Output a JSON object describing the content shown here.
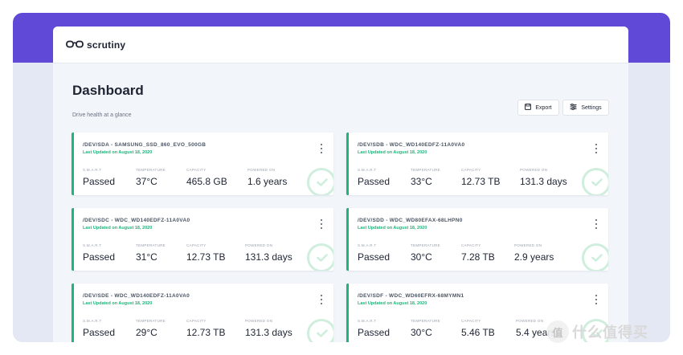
{
  "app": {
    "logo_text": "scrutiny"
  },
  "page": {
    "title": "Dashboard",
    "subtitle": "Drive health at a glance"
  },
  "toolbar": {
    "export_label": "Export",
    "settings_label": "Settings"
  },
  "stat_labels": {
    "smart": "S.M.A.R.T",
    "temperature": "TEMPERATURE",
    "capacity": "CAPACITY",
    "powered_on": "POWERED ON"
  },
  "drives": [
    {
      "name": "/DEV/SDA - SAMSUNG_SSD_860_EVO_500GB",
      "updated": "Last Updated on August 18, 2020",
      "smart": "Passed",
      "temperature": "37°C",
      "capacity": "465.8 GB",
      "powered_on": "1.6 years"
    },
    {
      "name": "/DEV/SDB - WDC_WD140EDFZ-11A0VA0",
      "updated": "Last Updated on August 18, 2020",
      "smart": "Passed",
      "temperature": "33°C",
      "capacity": "12.73 TB",
      "powered_on": "131.3 days"
    },
    {
      "name": "/DEV/SDC - WDC_WD140EDFZ-11A0VA0",
      "updated": "Last Updated on August 18, 2020",
      "smart": "Passed",
      "temperature": "31°C",
      "capacity": "12.73 TB",
      "powered_on": "131.3 days"
    },
    {
      "name": "/DEV/SDD - WDC_WD80EFAX-68LHPN0",
      "updated": "Last Updated on August 18, 2020",
      "smart": "Passed",
      "temperature": "30°C",
      "capacity": "7.28 TB",
      "powered_on": "2.9 years"
    },
    {
      "name": "/DEV/SDE - WDC_WD140EDFZ-11A0VA0",
      "updated": "Last Updated on August 18, 2020",
      "smart": "Passed",
      "temperature": "29°C",
      "capacity": "12.73 TB",
      "powered_on": "131.3 days"
    },
    {
      "name": "/DEV/SDF - WDC_WD60EFRX-68MYMN1",
      "updated": "Last Updated on August 18, 2020",
      "smart": "Passed",
      "temperature": "30°C",
      "capacity": "5.46 TB",
      "powered_on": "5.4 years"
    }
  ],
  "watermark": {
    "badge": "值",
    "text": "什么值得买"
  },
  "colors": {
    "brand_purple": "#5f49d6",
    "status_green": "#1fb47c",
    "page_bg": "#f2f5fa"
  }
}
